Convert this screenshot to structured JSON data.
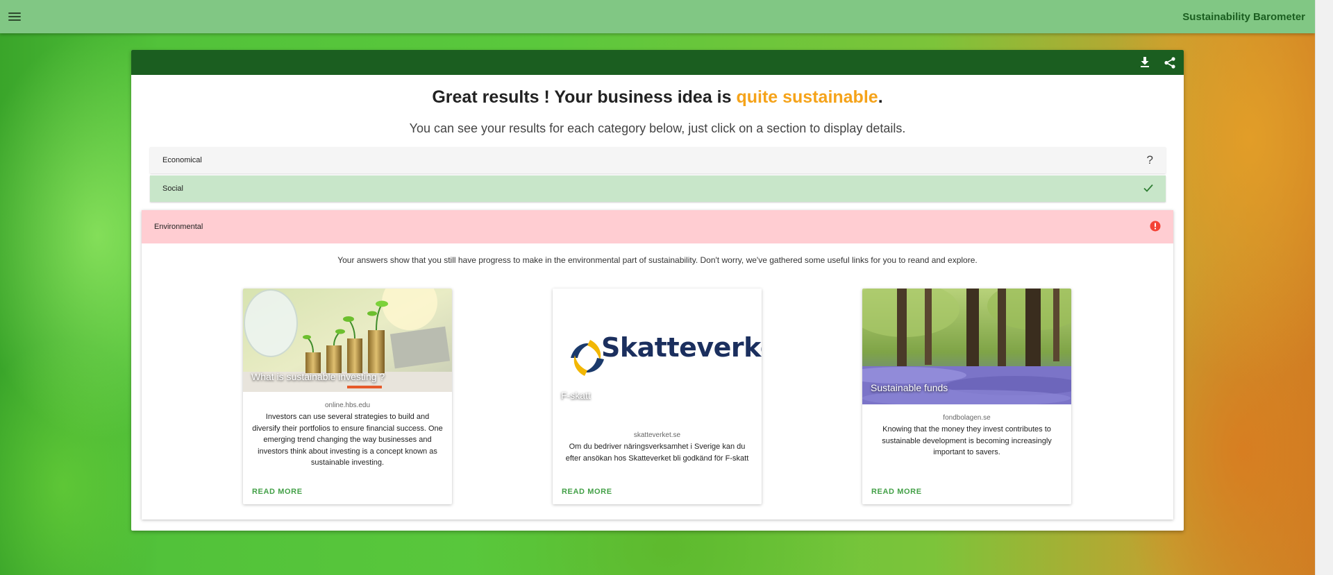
{
  "app": {
    "title": "Sustainability Barometer"
  },
  "result": {
    "headline_prefix": "Great results ! Your business idea is ",
    "headline_accent": "quite sustainable",
    "headline_suffix": ".",
    "subtitle": "You can see your results for each category below, just click on a section to display details."
  },
  "categories": [
    {
      "label": "Economical",
      "status_icon": "question-icon"
    },
    {
      "label": "Social",
      "status_icon": "check-icon"
    },
    {
      "label": "Environmental",
      "status_icon": "alert-icon"
    }
  ],
  "environmental": {
    "message": "Your answers show that you still have progress to make in the environmental part of sustainability. Don't worry, we've gathered some useful links for you to reand and explore.",
    "links": [
      {
        "title": "What is sustainable investing ?",
        "domain": "online.hbs.edu",
        "description": "Investors can use several strategies to build and diversify their portfolios to ensure financial success. One emerging trend changing the way businesses and investors think about investing is a concept known as sustainable investing.",
        "action": "READ MORE"
      },
      {
        "title": "F-skatt",
        "logo_text": "Skatteverket",
        "domain": "skatteverket.se",
        "description": "Om du bedriver näringsverksamhet i Sverige kan du efter ansökan hos Skatteverket bli godkänd för F-skatt",
        "action": "READ MORE"
      },
      {
        "title": "Sustainable funds",
        "domain": "fondbolagen.se",
        "description": "Knowing that the money they invest contributes to sustainable development is becoming increasingly important to savers.",
        "action": "READ MORE"
      }
    ]
  },
  "colors": {
    "appbar": "#81c784",
    "toolbar": "#1b5e20",
    "accent": "#f5a31a",
    "social_bg": "#c8e6c9",
    "env_bg": "#ffcdd2",
    "link": "#43a047",
    "alert": "#f44336"
  }
}
